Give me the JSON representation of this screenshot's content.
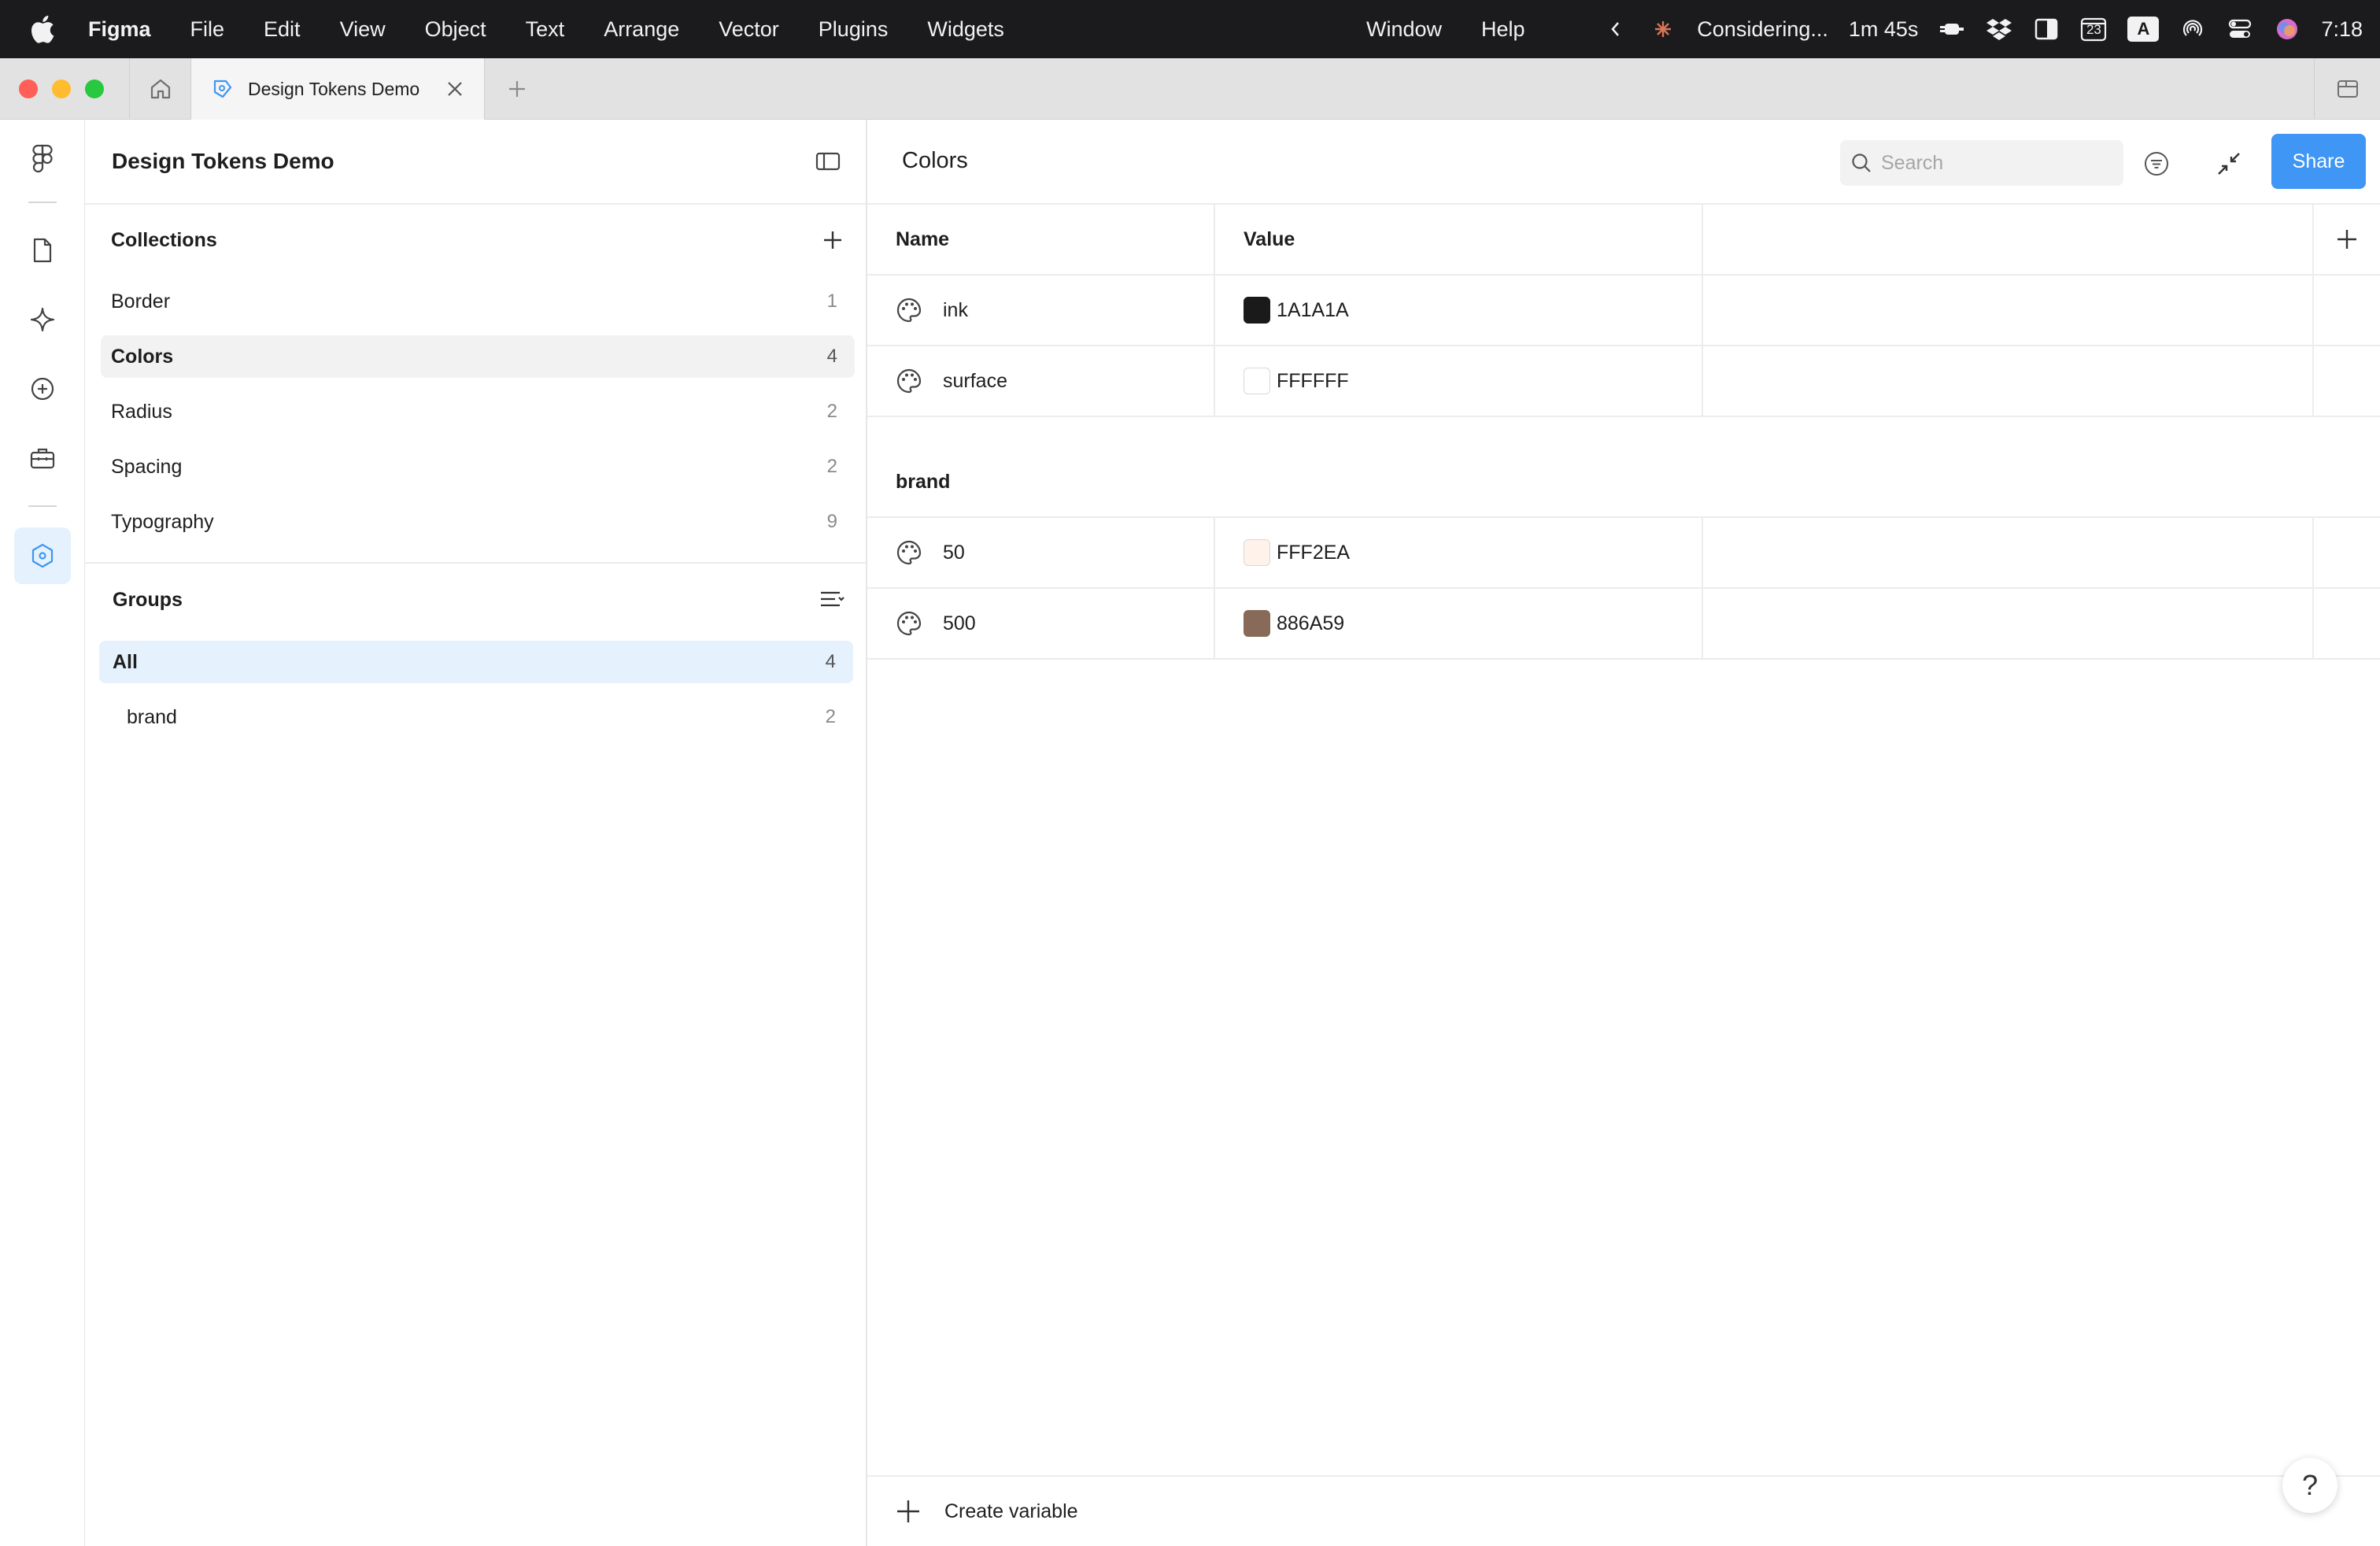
{
  "menubar": {
    "app": "Figma",
    "items": [
      "File",
      "Edit",
      "View",
      "Object",
      "Text",
      "Arrange",
      "Vector",
      "Plugins",
      "Widgets"
    ],
    "right_items": [
      "Window",
      "Help"
    ],
    "status_text": "Considering...",
    "timer": "1m 45s",
    "calendar_day": "23",
    "input_source": "A",
    "clock": "7:18"
  },
  "tabs": {
    "file_tab_label": "Design Tokens Demo"
  },
  "panel": {
    "title": "Design Tokens Demo",
    "collections_label": "Collections",
    "collections": [
      {
        "label": "Border",
        "count": "1"
      },
      {
        "label": "Colors",
        "count": "4",
        "selected": true
      },
      {
        "label": "Radius",
        "count": "2"
      },
      {
        "label": "Spacing",
        "count": "2"
      },
      {
        "label": "Typography",
        "count": "9"
      }
    ],
    "groups_label": "Groups",
    "groups": [
      {
        "label": "All",
        "count": "4",
        "selected": true
      },
      {
        "label": "brand",
        "count": "2"
      }
    ]
  },
  "main": {
    "title": "Colors",
    "search_placeholder": "Search",
    "share_label": "Share",
    "columns": {
      "name": "Name",
      "value": "Value"
    },
    "variables": [
      {
        "name": "ink",
        "value": "1A1A1A",
        "color": "#1A1A1A"
      },
      {
        "name": "surface",
        "value": "FFFFFF",
        "color": "#FFFFFF"
      }
    ],
    "group_brand": {
      "label": "brand",
      "variables": [
        {
          "name": "50",
          "value": "FFF2EA",
          "color": "#FFF2EA"
        },
        {
          "name": "500",
          "value": "886A59",
          "color": "#886A59"
        }
      ]
    },
    "create_label": "Create variable",
    "help_label": "?"
  },
  "colors": {
    "accent": "#3F96F4",
    "selection": "#E5F1FC",
    "menubar_bg": "#1B1B1D"
  },
  "icons": {
    "menubar": [
      "apple-icon",
      "chevron-left-icon",
      "claude-spark-icon",
      "battery-plug-icon",
      "dropbox-icon",
      "sidebar-icon",
      "calendar-icon",
      "input-source-icon",
      "airdrop-icon",
      "control-center-icon",
      "siri-icon"
    ],
    "rail": [
      "figma-logo-icon",
      "file-icon",
      "sparkle-icon",
      "plus-circle-icon",
      "toolbox-icon",
      "variables-icon"
    ]
  }
}
